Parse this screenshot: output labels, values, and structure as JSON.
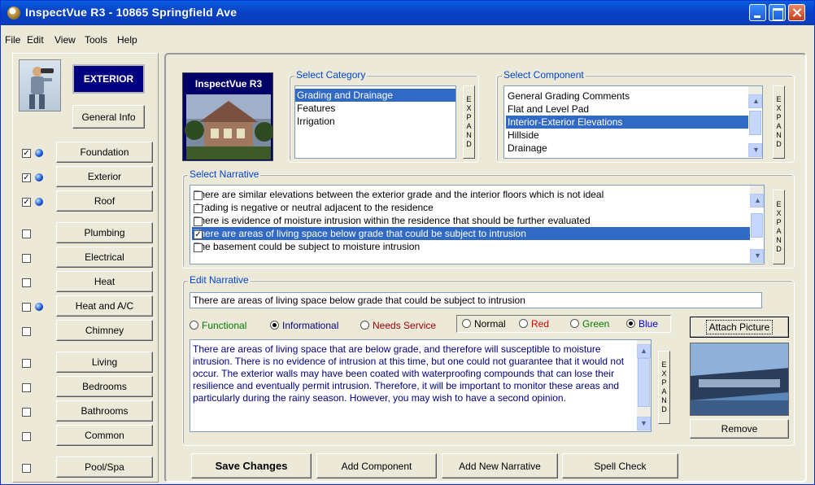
{
  "window": {
    "title": "InspectVue R3 - 10865 Springfield Ave"
  },
  "menu": [
    "File",
    "Edit",
    "View",
    "Tools",
    "Help"
  ],
  "sidebar": {
    "section_label": "EXTERIOR",
    "general_info": "General Info",
    "items": [
      {
        "label": "Foundation",
        "checked": true,
        "orb": true
      },
      {
        "label": "Exterior",
        "checked": true,
        "orb": true
      },
      {
        "label": "Roof",
        "checked": true,
        "orb": true
      },
      {
        "label": "Plumbing",
        "checked": false,
        "orb": false
      },
      {
        "label": "Electrical",
        "checked": false,
        "orb": false
      },
      {
        "label": "Heat",
        "checked": false,
        "orb": false
      },
      {
        "label": "Heat and A/C",
        "checked": false,
        "orb": true
      },
      {
        "label": "Chimney",
        "checked": false,
        "orb": false
      },
      {
        "label": "Living",
        "checked": false,
        "orb": false
      },
      {
        "label": "Bedrooms",
        "checked": false,
        "orb": false
      },
      {
        "label": "Bathrooms",
        "checked": false,
        "orb": false
      },
      {
        "label": "Common",
        "checked": false,
        "orb": false
      },
      {
        "label": "Pool/Spa",
        "checked": false,
        "orb": false
      }
    ]
  },
  "logo": {
    "title": "InspectVue R3"
  },
  "category": {
    "label": "Select Category",
    "items": [
      "Grading and Drainage",
      "Features",
      "Irrigation"
    ],
    "selected": 0
  },
  "component": {
    "label": "Select Component",
    "items": [
      "General Grading Comments",
      "Flat and Level Pad",
      "Interior-Exterior Elevations",
      "Hillside",
      "Drainage"
    ],
    "selected": 2
  },
  "expand_letters": [
    "E",
    "X",
    "P",
    "A",
    "N",
    "D"
  ],
  "narrative": {
    "label": "Select Narrative",
    "items": [
      {
        "text": "There are similar elevations between the exterior grade and the interior floors which is not ideal",
        "checked": false
      },
      {
        "text": "Grading is negative or neutral adjacent to the residence",
        "checked": false
      },
      {
        "text": "There is evidence of moisture intrusion within the residence that should be further evaluated",
        "checked": false
      },
      {
        "text": "There are areas of living space below grade that could be subject to intrusion",
        "checked": true
      },
      {
        "text": "The basement could be subject to moisture intrusion",
        "checked": false
      }
    ],
    "selected": 3
  },
  "edit": {
    "label": "Edit Narrative",
    "summary": "There are areas of living space below grade that could be subject to intrusion",
    "type_options": [
      {
        "label": "Functional",
        "color": "#007a00",
        "selected": false
      },
      {
        "label": "Informational",
        "color": "#000080",
        "selected": true
      },
      {
        "label": "Needs Service",
        "color": "#a00000",
        "selected": false
      }
    ],
    "color_options": [
      {
        "label": "Normal",
        "color": "#000000",
        "selected": false
      },
      {
        "label": "Red",
        "color": "#e00000",
        "selected": false
      },
      {
        "label": "Green",
        "color": "#008000",
        "selected": false
      },
      {
        "label": "Blue",
        "color": "#0000d0",
        "selected": true
      }
    ],
    "body": "There are areas of living space that are below grade, and therefore will susceptible to moisture intrusion. There is no evidence of intrusion at this time, but one could not guarantee that it would not occur. The exterior walls may have been coated with waterproofing compounds that can lose their resilience and eventually permit intrusion. Therefore, it will be important to monitor these areas and particularly during the rainy season. However, you may wish to have a second opinion.",
    "attach": "Attach Picture",
    "remove": "Remove"
  },
  "actions": {
    "save": "Save Changes",
    "add_component": "Add Component",
    "add_narrative": "Add New Narrative",
    "spell_check": "Spell Check"
  }
}
